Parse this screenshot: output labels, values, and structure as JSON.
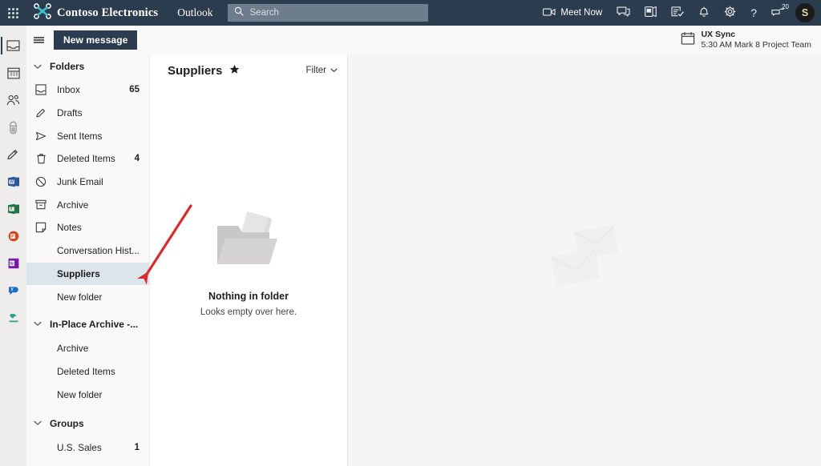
{
  "suite": {
    "waffle_label": "app-launcher",
    "brand": "Contoso Electronics",
    "app": "Outlook",
    "search_placeholder": "Search",
    "search_value": "",
    "meet_now": "Meet Now",
    "feedback_badge": "20",
    "avatar_initial": "S",
    "bar_color": "#2b3c4e",
    "icons": [
      {
        "name": "meet-now-icon",
        "label": "Meet Now"
      },
      {
        "name": "teams-chat-icon",
        "label": "Teams chat"
      },
      {
        "name": "outlook-calendar-icon",
        "label": "Calendar"
      },
      {
        "name": "tasks-icon",
        "label": "To Do"
      },
      {
        "name": "bell-icon",
        "label": "Notifications"
      },
      {
        "name": "gear-icon",
        "label": "Settings"
      },
      {
        "name": "help-icon",
        "label": "Help"
      },
      {
        "name": "feedback-icon",
        "label": "Feedback"
      }
    ]
  },
  "rail": {
    "items": [
      {
        "name": "rail-item-mail",
        "label": "Mail",
        "active": true
      },
      {
        "name": "rail-item-calendar",
        "label": "Calendar",
        "active": false
      },
      {
        "name": "rail-item-people",
        "label": "People",
        "active": false
      },
      {
        "name": "rail-item-files",
        "label": "Files",
        "active": false
      },
      {
        "name": "rail-item-todo",
        "label": "To Do",
        "active": false
      },
      {
        "name": "rail-item-word",
        "label": "Word",
        "active": false
      },
      {
        "name": "rail-item-excel",
        "label": "Excel",
        "active": false
      },
      {
        "name": "rail-item-powerpoint",
        "label": "PowerPoint",
        "active": false
      },
      {
        "name": "rail-item-onenote",
        "label": "OneNote",
        "active": false
      },
      {
        "name": "rail-item-yammer",
        "label": "Yammer",
        "active": false
      },
      {
        "name": "rail-item-bookings",
        "label": "Bookings",
        "active": false
      }
    ]
  },
  "command_bar": {
    "new_message_label": "New message",
    "meeting": {
      "title": "UX Sync",
      "subtitle": "5:30 AM Mark 8 Project Team"
    }
  },
  "folders": {
    "section_folders": {
      "title": "Folders",
      "items": [
        {
          "label": "Inbox",
          "count": "65",
          "icon": "inbox-icon",
          "nested": false,
          "selected": false
        },
        {
          "label": "Drafts",
          "count": "",
          "icon": "pencil-icon",
          "nested": false,
          "selected": false
        },
        {
          "label": "Sent Items",
          "count": "",
          "icon": "send-icon",
          "nested": false,
          "selected": false
        },
        {
          "label": "Deleted Items",
          "count": "4",
          "icon": "trash-icon",
          "nested": false,
          "selected": false
        },
        {
          "label": "Junk Email",
          "count": "",
          "icon": "block-icon",
          "nested": false,
          "selected": false
        },
        {
          "label": "Archive",
          "count": "",
          "icon": "archive-icon",
          "nested": false,
          "selected": false
        },
        {
          "label": "Notes",
          "count": "",
          "icon": "note-icon",
          "nested": false,
          "selected": false
        },
        {
          "label": "Conversation Hist...",
          "count": "",
          "icon": "",
          "nested": true,
          "selected": false
        },
        {
          "label": "Suppliers",
          "count": "",
          "icon": "",
          "nested": true,
          "selected": true
        },
        {
          "label": "New folder",
          "count": "",
          "icon": "",
          "nested": true,
          "selected": false
        }
      ]
    },
    "section_archive": {
      "title": "In-Place Archive -...",
      "items": [
        {
          "label": "Archive",
          "count": "",
          "icon": "",
          "nested": true,
          "selected": false
        },
        {
          "label": "Deleted Items",
          "count": "",
          "icon": "",
          "nested": true,
          "selected": false
        },
        {
          "label": "New folder",
          "count": "",
          "icon": "",
          "nested": true,
          "selected": false
        }
      ]
    },
    "section_groups": {
      "title": "Groups",
      "items": [
        {
          "label": "U.S. Sales",
          "count": "1",
          "icon": "",
          "nested": true,
          "selected": false
        }
      ]
    }
  },
  "message_list": {
    "title": "Suppliers",
    "favorite_icon": "star-filled-icon",
    "filter_label": "Filter",
    "empty_title": "Nothing in folder",
    "empty_subtitle": "Looks empty over here."
  },
  "reading_pane": {
    "watermark": "envelopes-illustration"
  },
  "annotation": {
    "type": "red-arrow",
    "color": "#d92b2b",
    "points_to": "Suppliers"
  }
}
